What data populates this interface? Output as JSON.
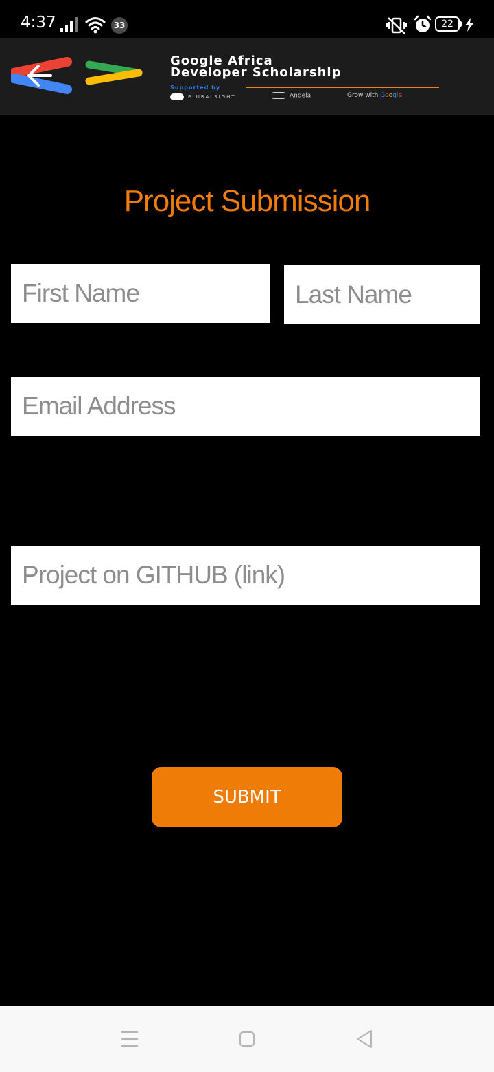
{
  "status_bar": {
    "time": "4:37",
    "notification_count": "33",
    "battery_level": "22",
    "icons": [
      "signal-icon",
      "wifi-icon",
      "vibrate-off-icon",
      "alarm-icon",
      "battery-icon",
      "charging-icon"
    ]
  },
  "banner": {
    "title_line1": "Google Africa",
    "title_line2": "Developer Scholarship",
    "supported_by": "Supported by",
    "sponsors": {
      "pluralsight": "PLURALSIGHT",
      "andela": "Andela",
      "grow_prefix": "Grow with",
      "grow_google": [
        "G",
        "o",
        "o",
        "g",
        "l",
        "e"
      ]
    },
    "colors": {
      "background": "#1c1c1c",
      "rule": "#e5870f",
      "supported": "#2f7df6"
    }
  },
  "page": {
    "title": "Project Submission",
    "title_color": "#f07c0c"
  },
  "form": {
    "first_name": {
      "placeholder": "First Name",
      "value": ""
    },
    "last_name": {
      "placeholder": "Last Name",
      "value": ""
    },
    "email": {
      "placeholder": "Email Address",
      "value": ""
    },
    "github": {
      "placeholder": "Project on GITHUB (link)",
      "value": ""
    },
    "submit_label": "SUBMIT",
    "submit_color": "#f07c08"
  },
  "nav_bar": {
    "icons": [
      "recent-apps-icon",
      "home-icon",
      "back-triangle-icon"
    ]
  }
}
